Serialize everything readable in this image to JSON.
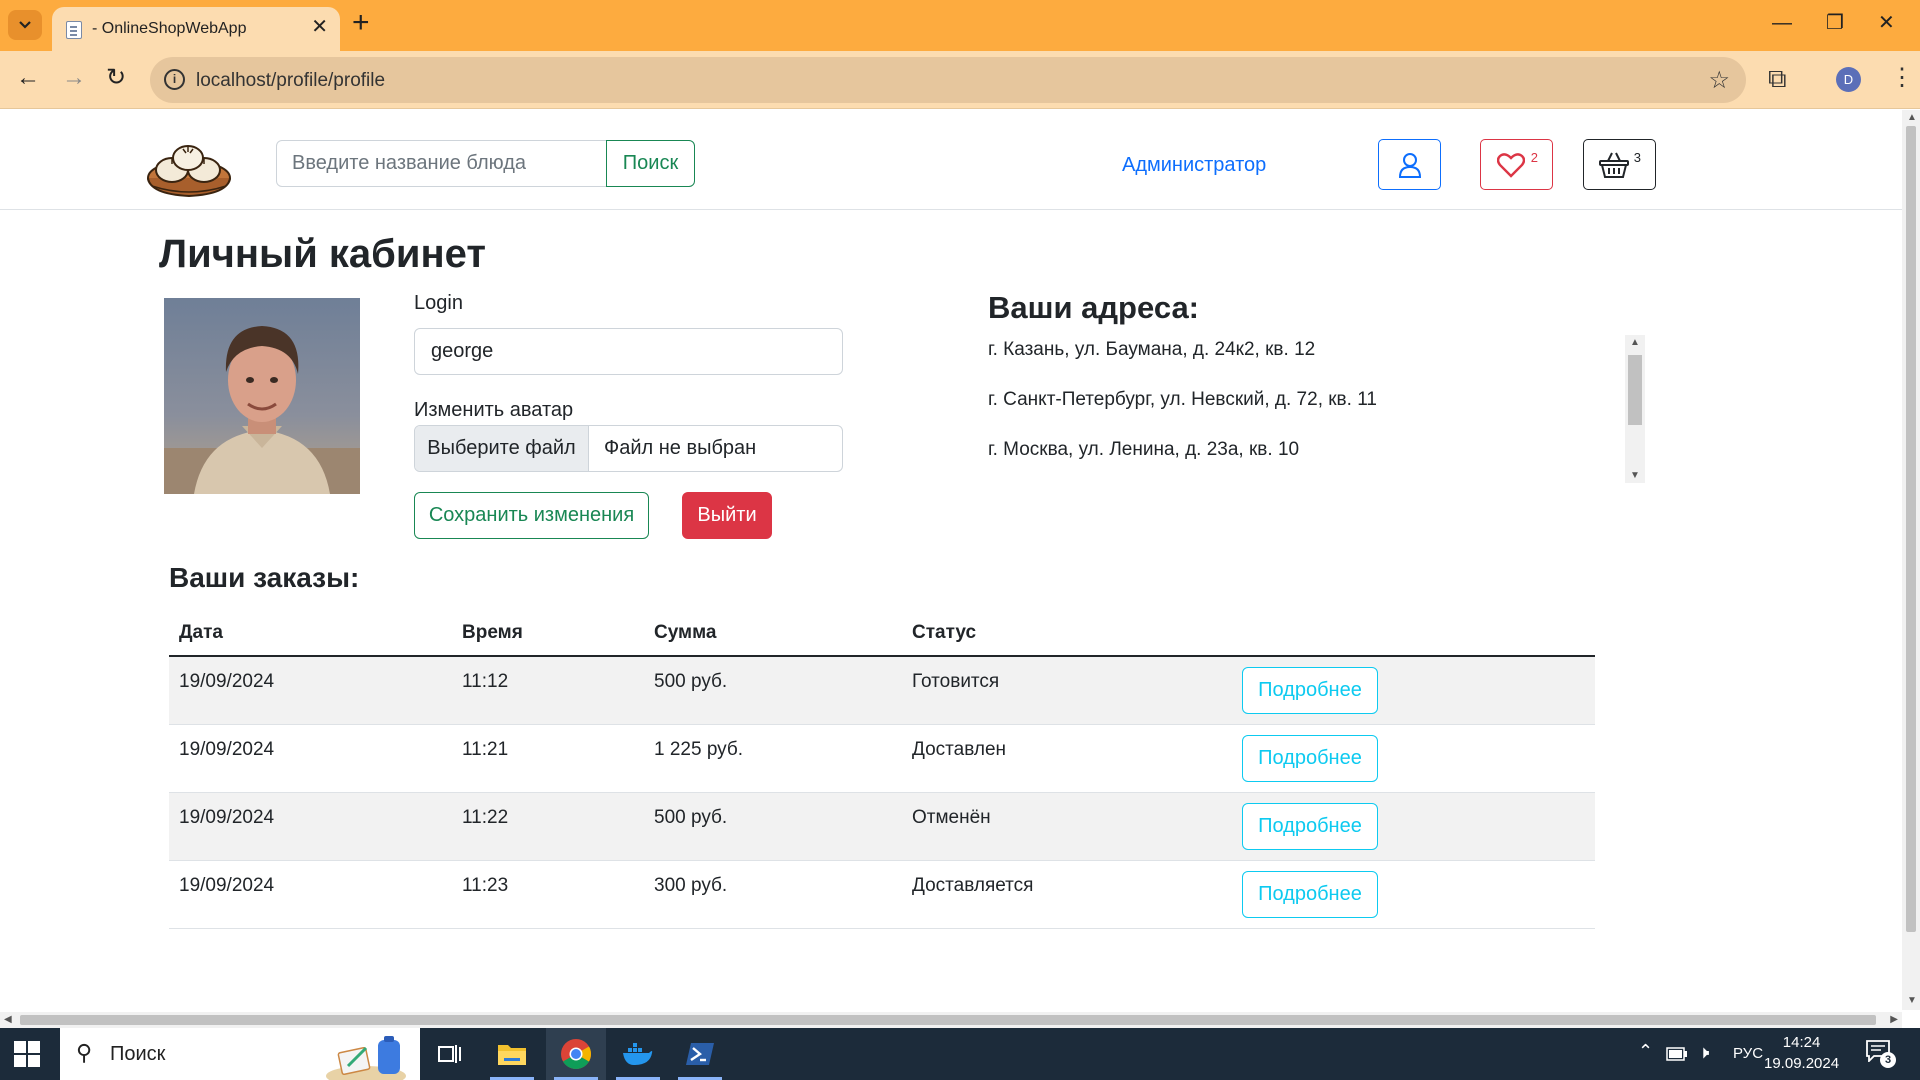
{
  "browser": {
    "tab_title": "- OnlineShopWebApp",
    "url": "localhost/profile/profile",
    "profile_initial": "D"
  },
  "header": {
    "search_placeholder": "Введите название блюда",
    "search_button": "Поиск",
    "admin_link": "Администратор",
    "favorites_count": "2",
    "cart_count": "3"
  },
  "profile": {
    "title": "Личный кабинет",
    "login_label": "Login",
    "login_value": "george",
    "avatar_label": "Изменить аватар",
    "file_button": "Выберите файл",
    "file_status": "Файл не выбран",
    "save_button": "Сохранить изменения",
    "logout_button": "Выйти"
  },
  "addresses": {
    "title": "Ваши адреса:",
    "items": [
      "г. Казань, ул. Баумана, д. 24к2, кв. 12",
      "г. Санкт-Петербург, ул. Невский, д. 72, кв. 11",
      "г. Москва, ул. Ленина, д. 23а, кв. 10"
    ]
  },
  "orders": {
    "title": "Ваши заказы:",
    "columns": [
      "Дата",
      "Время",
      "Сумма",
      "Статус"
    ],
    "detail_label": "Подробнее",
    "rows": [
      {
        "date": "19/09/2024",
        "time": "11:12",
        "sum": "500 руб.",
        "status": "Готовится"
      },
      {
        "date": "19/09/2024",
        "time": "11:21",
        "sum": "1 225 руб.",
        "status": "Доставлен"
      },
      {
        "date": "19/09/2024",
        "time": "11:22",
        "sum": "500 руб.",
        "status": "Отменён"
      },
      {
        "date": "19/09/2024",
        "time": "11:23",
        "sum": "300 руб.",
        "status": "Доставляется"
      }
    ]
  },
  "taskbar": {
    "search_text": "Поиск",
    "language": "РУС",
    "time": "14:24",
    "date": "19.09.2024",
    "notification_count": "3"
  },
  "colors": {
    "browser_frame": "#fdab3f",
    "success": "#198754",
    "danger": "#dc3545",
    "info": "#0dcaf0",
    "primary": "#0d6efd"
  }
}
